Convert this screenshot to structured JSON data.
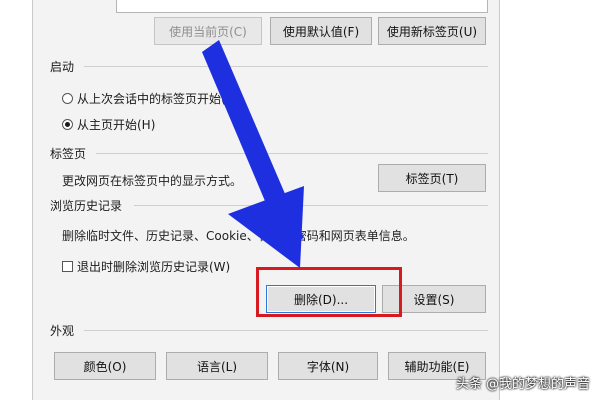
{
  "buttons_top": {
    "use_current": "使用当前页(C)",
    "use_default": "使用默认值(F)",
    "use_new_tab": "使用新标签页(U)"
  },
  "startup": {
    "title": "启动",
    "option1": "从上次会话中的标签页开始(B)",
    "option2": "从主页开始(H)",
    "selected": "option2"
  },
  "tabs": {
    "title": "标签页",
    "description": "更改网页在标签页中的显示方式。",
    "button": "标签页(T)"
  },
  "history": {
    "title": "浏览历史记录",
    "description": "删除临时文件、历史记录、Cookie、保存的密码和网页表单信息。",
    "checkbox_label": "退出时删除浏览历史记录(W)",
    "checkbox_checked": false,
    "delete_button": "删除(D)...",
    "settings_button": "设置(S)"
  },
  "appearance": {
    "title": "外观",
    "colors_button": "颜色(O)",
    "languages_button": "语言(L)",
    "fonts_button": "字体(N)",
    "accessibility_button": "辅助功能(E)"
  },
  "annotation": {
    "arrow_color": "#1e2fe0",
    "highlight_color": "#d71920"
  },
  "watermark": "头条 @我的梦想的声音"
}
